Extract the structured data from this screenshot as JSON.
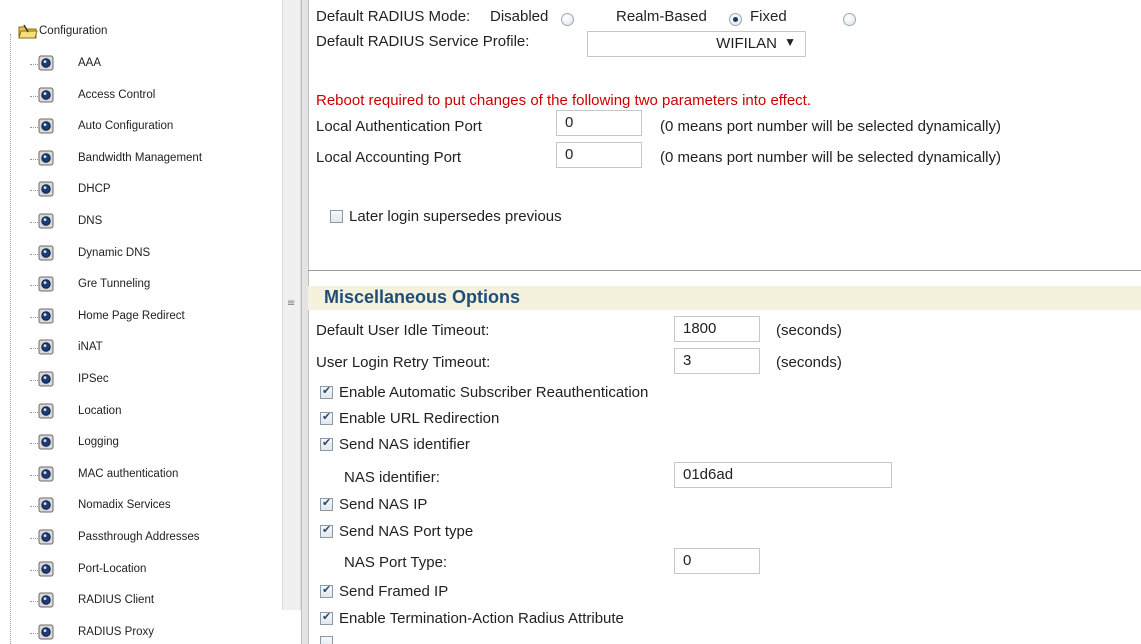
{
  "tree": {
    "root_label": "Configuration",
    "items": [
      {
        "label": "AAA"
      },
      {
        "label": "Access Control"
      },
      {
        "label": "Auto Configuration"
      },
      {
        "label": "Bandwidth Management"
      },
      {
        "label": "DHCP"
      },
      {
        "label": "DNS"
      },
      {
        "label": "Dynamic DNS"
      },
      {
        "label": "Gre Tunneling"
      },
      {
        "label": "Home Page Redirect"
      },
      {
        "label": "iNAT"
      },
      {
        "label": "IPSec"
      },
      {
        "label": "Location"
      },
      {
        "label": "Logging"
      },
      {
        "label": "MAC authentication"
      },
      {
        "label": "Nomadix Services"
      },
      {
        "label": "Passthrough Addresses"
      },
      {
        "label": "Port-Location"
      },
      {
        "label": "RADIUS Client"
      },
      {
        "label": "RADIUS Proxy"
      }
    ],
    "folder_icon": "folder-icon",
    "page_icon": "page-icon"
  },
  "radius": {
    "mode_label": "Default RADIUS Mode:",
    "options": [
      {
        "label": "Disabled",
        "selected": false
      },
      {
        "label": "Realm-Based",
        "selected": true
      },
      {
        "label": "Fixed",
        "selected": false
      }
    ],
    "profile_label": "Default RADIUS Service Profile:",
    "profile_value": "WIFILAN"
  },
  "reboot_notice": "Reboot required to put changes of the following two parameters into effect.",
  "ports": {
    "auth_label": "Local Authentication Port",
    "auth_value": "0",
    "auth_note": "(0 means port number will be selected dynamically)",
    "acct_label": "Local Accounting Port",
    "acct_value": "0",
    "acct_note": "(0 means port number will be selected dynamically)"
  },
  "later_login": {
    "label": "Later login supersedes previous",
    "checked": false
  },
  "misc": {
    "header": "Miscellaneous Options",
    "idle_label": "Default User Idle Timeout:",
    "idle_value": "1800",
    "idle_unit": "(seconds)",
    "retry_label": "User Login Retry Timeout:",
    "retry_value": "3",
    "retry_unit": "(seconds)",
    "reauth_label": "Enable Automatic Subscriber Reauthentication",
    "url_redirect_label": "Enable URL Redirection",
    "send_nas_id_label": "Send NAS identifier",
    "nas_id_label": "NAS identifier:",
    "nas_id_value": "01d6ad",
    "send_nas_ip_label": "Send NAS IP",
    "send_nas_port_label": "Send NAS Port type",
    "nas_port_label": "NAS Port Type:",
    "nas_port_value": "0",
    "send_framed_ip_label": "Send Framed IP",
    "term_action_label": "Enable Termination-Action Radius Attribute"
  },
  "colors": {
    "accent": "#1f4e79",
    "notice": "#cc0000",
    "header_bg": "#f4f2dc"
  }
}
